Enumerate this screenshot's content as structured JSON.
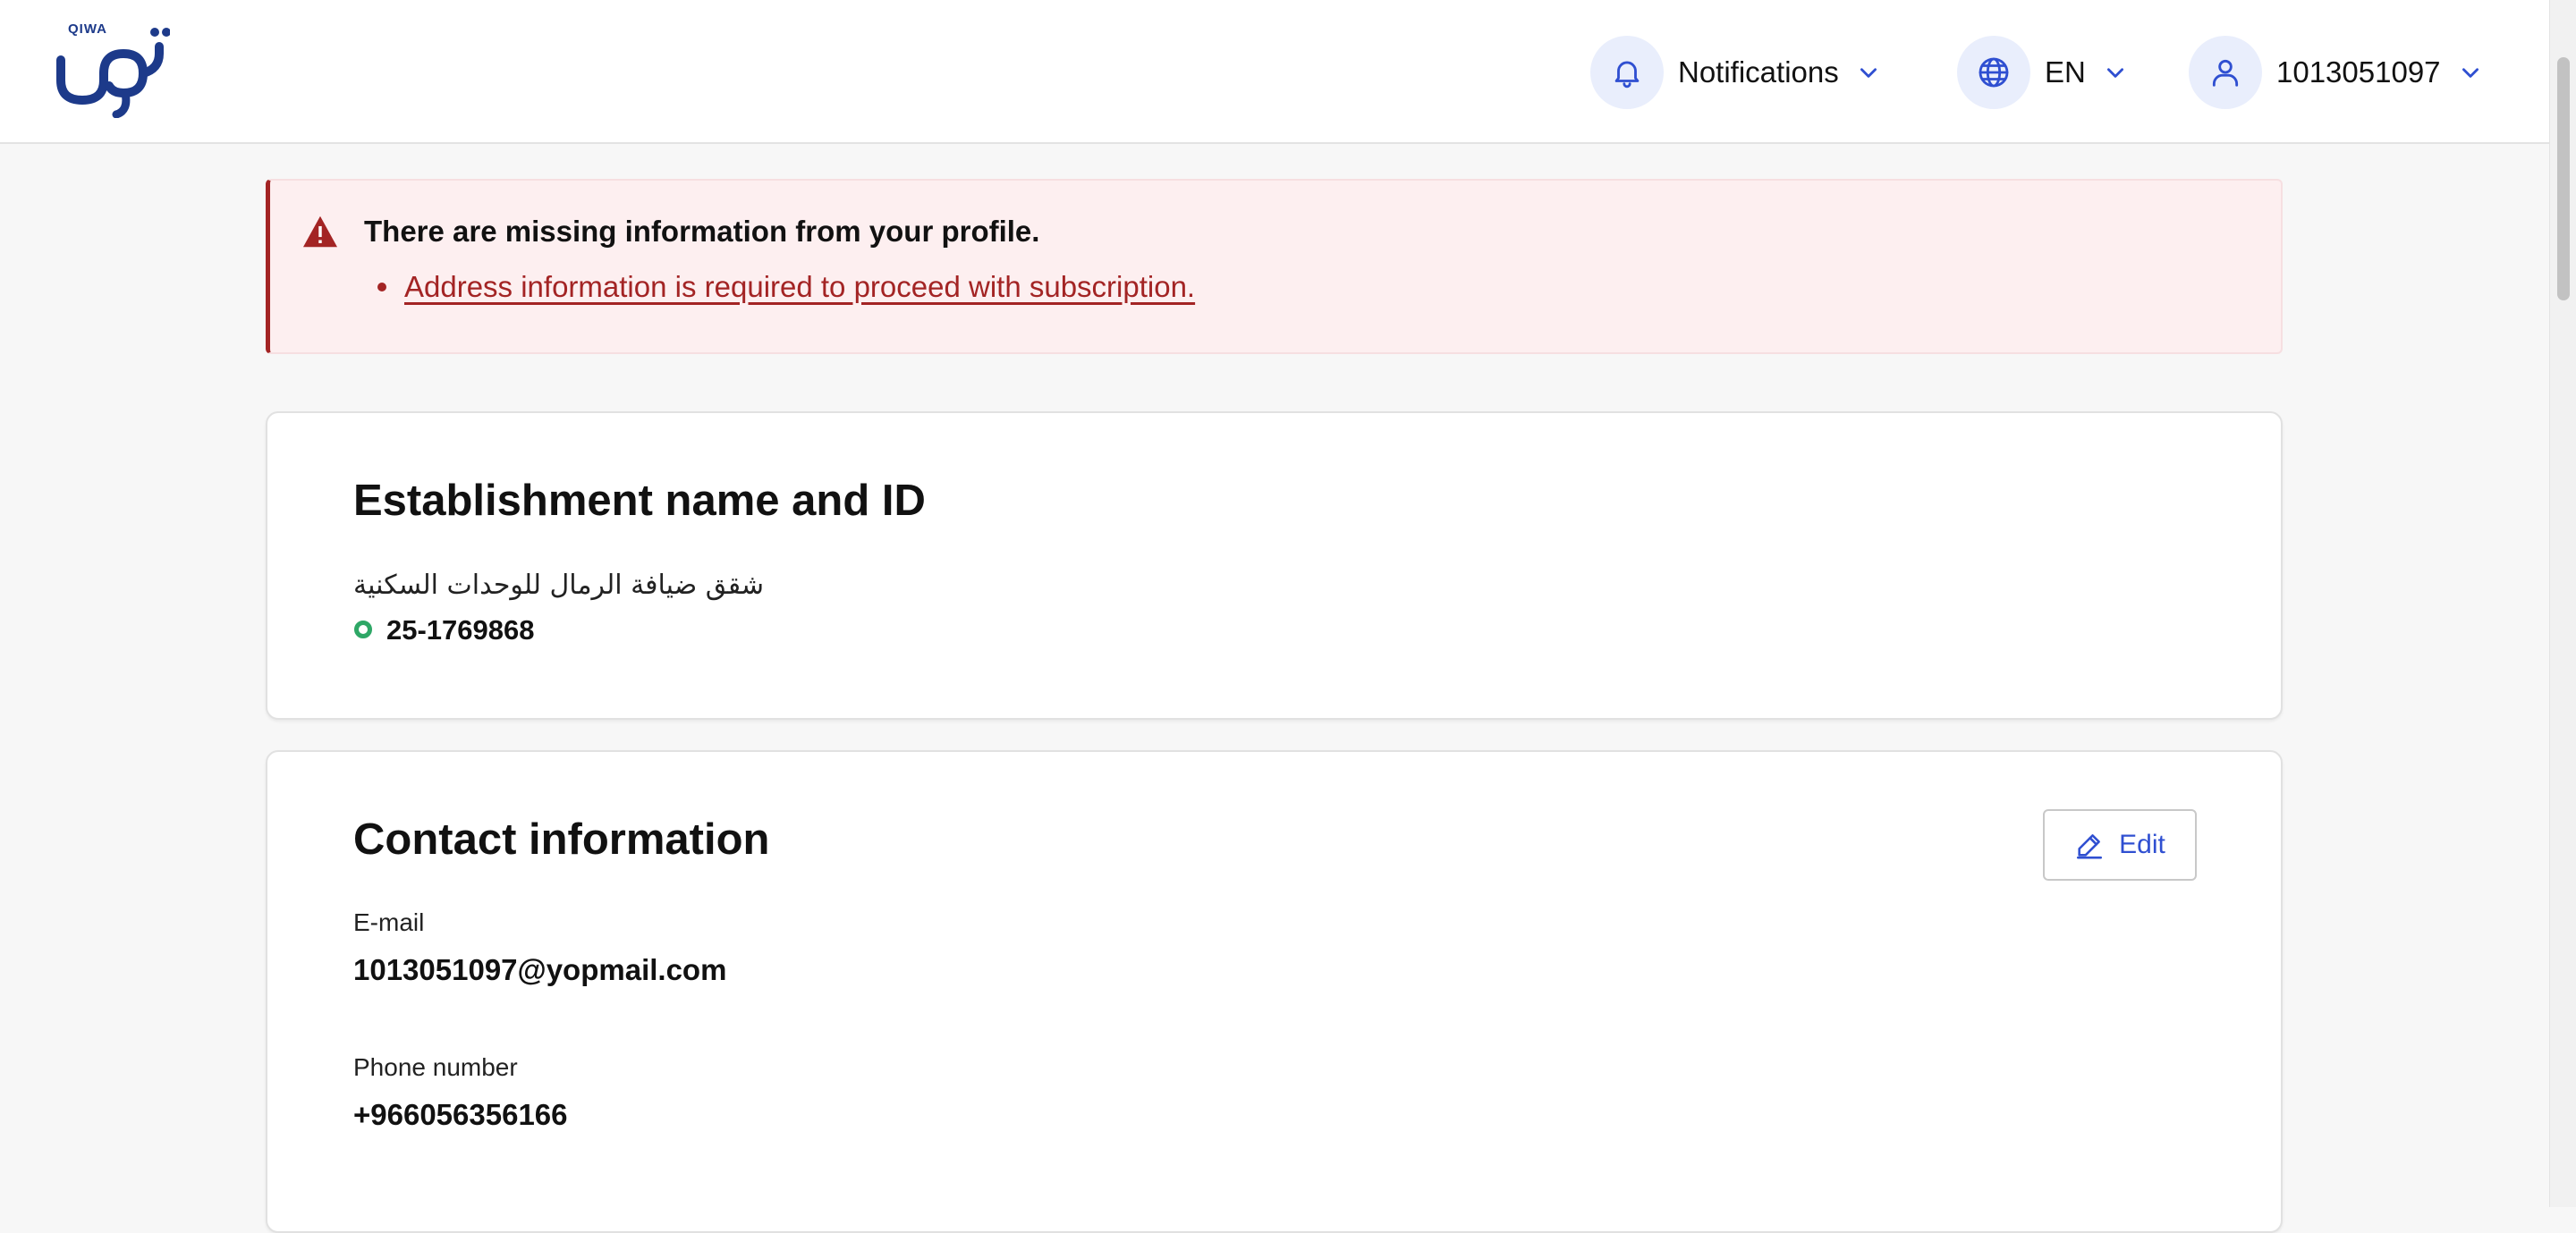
{
  "header": {
    "logo_text": "QIWA",
    "notifications_label": "Notifications",
    "language_label": "EN",
    "user_label": "1013051097"
  },
  "alert": {
    "title": "There are missing information from your profile.",
    "items": [
      "Address information is required to proceed with subscription."
    ],
    "color": "#a32424"
  },
  "establishment": {
    "title": "Establishment name and ID",
    "name": "شقق ضيافة الرمال للوحدات السكنية",
    "id": "25-1769868",
    "status_color": "#2ea766"
  },
  "contact": {
    "title": "Contact information",
    "edit_label": "Edit",
    "email_label": "E-mail",
    "email_value": "1013051097@yopmail.com",
    "phone_label": "Phone number",
    "phone_value": "+966056356166"
  },
  "colors": {
    "accent": "#2f4fd1",
    "brand": "#1d3a8a"
  }
}
